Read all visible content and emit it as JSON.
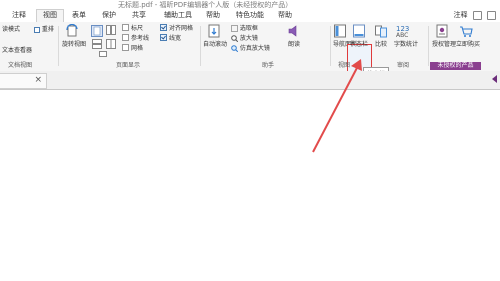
{
  "window": {
    "title": "无标题.pdf - 福昕PDF编辑器个人版（未经授权的产品）"
  },
  "tabs": [
    {
      "label": "注释"
    },
    {
      "label": "视图"
    },
    {
      "label": "表单"
    },
    {
      "label": "保护"
    },
    {
      "label": "共享"
    },
    {
      "label": "辅助工具"
    },
    {
      "label": "帮助"
    },
    {
      "label": "特色功能"
    },
    {
      "label": "帮助"
    }
  ],
  "right_tools": {
    "label": "注释"
  },
  "ribbon": {
    "doc_view": {
      "read_mode": "读模式",
      "reflow": "重排",
      "text_viewer": "文本查看器",
      "group_label": "文档视图"
    },
    "page_display": {
      "rotate_view": "旋转视图",
      "ruler": "标尺",
      "guides": "参考线",
      "grid": "网格",
      "snap_grid": "对齐网格",
      "line_weight": "线宽",
      "group_label": "页面显示"
    },
    "assist": {
      "auto_scroll": "自动滚动",
      "marquee": "选取框",
      "magnifier": "放大镜",
      "loupe": "仿真放大镜",
      "read_aloud": "朗读",
      "group_label": "助手"
    },
    "view": {
      "nav_panels": "导航面板",
      "status_bar": "状态栏",
      "compare": "比较",
      "word_count": "字数统计",
      "group_label": "视图",
      "review_label": "审阅"
    },
    "license": {
      "manage": "授权管理",
      "buy": "立即购买",
      "banner": "未授权的产品"
    }
  },
  "tooltip": {
    "text": "状态栏"
  },
  "document_tab": {
    "close": "×"
  },
  "colors": {
    "accent": "#8a3f8f",
    "highlight": "#e03b3b",
    "arrow": "#e24b4b"
  }
}
